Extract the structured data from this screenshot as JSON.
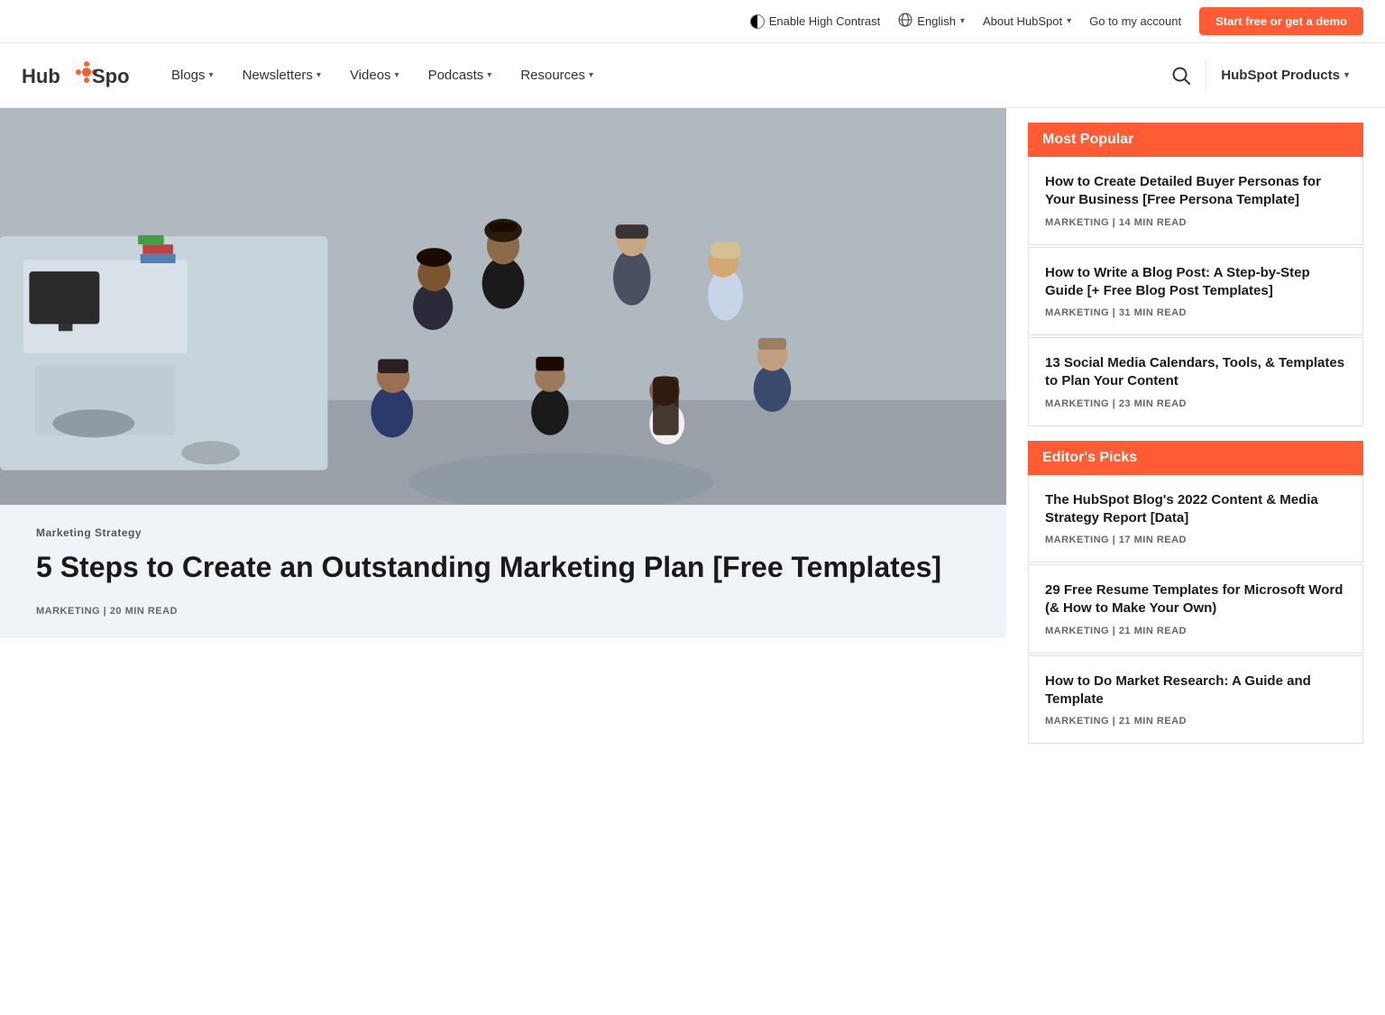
{
  "topbar": {
    "high_contrast_label": "Enable High Contrast",
    "language_label": "English",
    "about_label": "About HubSpot",
    "account_label": "Go to my account",
    "cta_label": "Start free or get a demo"
  },
  "nav": {
    "logo_alt": "HubSpot",
    "items": [
      {
        "label": "Blogs",
        "has_dropdown": true
      },
      {
        "label": "Newsletters",
        "has_dropdown": true
      },
      {
        "label": "Videos",
        "has_dropdown": true
      },
      {
        "label": "Podcasts",
        "has_dropdown": true
      },
      {
        "label": "Resources",
        "has_dropdown": true
      }
    ],
    "products_label": "HubSpot Products",
    "search_icon": "search-icon"
  },
  "hero": {
    "category": "Marketing Strategy",
    "title": "5 Steps to Create an Outstanding Marketing Plan [Free Templates]",
    "meta_category": "MARKETING",
    "separator": "|",
    "read_time": "20 MIN READ"
  },
  "sidebar": {
    "most_popular": {
      "section_title": "Most Popular",
      "items": [
        {
          "title": "How to Create Detailed Buyer Personas for Your Business [Free Persona Template]",
          "category": "MARKETING",
          "read_time": "14 MIN READ"
        },
        {
          "title": "How to Write a Blog Post: A Step-by-Step Guide [+ Free Blog Post Templates]",
          "category": "MARKETING",
          "read_time": "31 MIN READ"
        },
        {
          "title": "13 Social Media Calendars, Tools, & Templates to Plan Your Content",
          "category": "MARKETING",
          "read_time": "23 MIN READ"
        }
      ]
    },
    "editors_picks": {
      "section_title": "Editor's Picks",
      "items": [
        {
          "title": "The HubSpot Blog's 2022 Content & Media Strategy Report [Data]",
          "category": "MARKETING",
          "read_time": "17 MIN READ"
        },
        {
          "title": "29 Free Resume Templates for Microsoft Word (& How to Make Your Own)",
          "category": "MARKETING",
          "read_time": "21 MIN READ"
        },
        {
          "title": "How to Do Market Research: A Guide and Template",
          "category": "MARKETING",
          "read_time": "21 MIN READ"
        }
      ]
    }
  },
  "colors": {
    "accent": "#ff5c35",
    "text_primary": "#1a1a1a",
    "text_secondary": "#666",
    "border": "#e0e0e0"
  }
}
